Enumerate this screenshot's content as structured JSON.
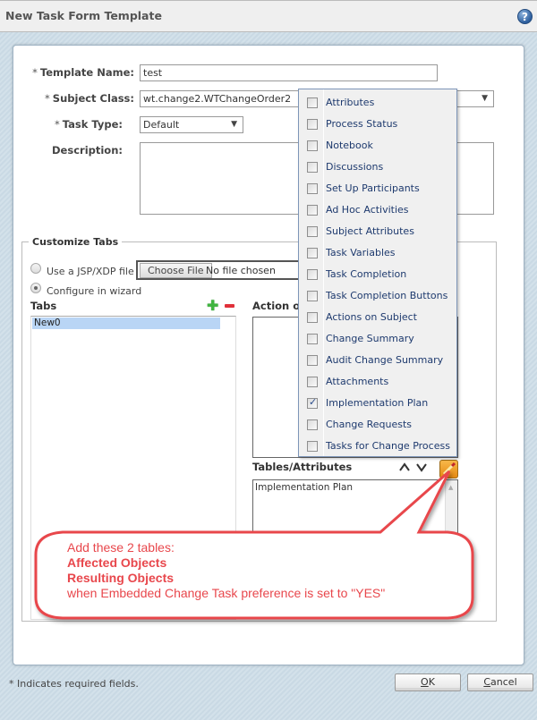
{
  "window": {
    "title": "New Task Form Template",
    "help_icon": "question-mark-icon"
  },
  "form": {
    "required_marker": "*",
    "template_name": {
      "label": "Template Name:",
      "value": "test",
      "required": true
    },
    "subject_class": {
      "label": "Subject Class:",
      "value": "wt.change2.WTChangeOrder2",
      "required": true
    },
    "task_type": {
      "label": "Task Type:",
      "value": "Default",
      "required": true
    },
    "description": {
      "label": "Description:",
      "value": ""
    }
  },
  "customize_tabs": {
    "legend": "Customize Tabs",
    "radio_jsp": {
      "label": "Use a JSP/XDP file",
      "selected": false
    },
    "radio_wizard": {
      "label": "Configure in wizard",
      "selected": true
    },
    "file_input": {
      "button": "Choose File",
      "status": "No file chosen"
    },
    "tabs_header": "Tabs",
    "tabs": [
      {
        "label": "New0",
        "selected": true
      }
    ],
    "action_header": "Action on",
    "tables_header": "Tables/Attributes",
    "tables_list": [
      "Implementation Plan"
    ]
  },
  "tables_dropdown": {
    "items": [
      {
        "label": "Attributes",
        "checked": false
      },
      {
        "label": "Process Status",
        "checked": false
      },
      {
        "label": "Notebook",
        "checked": false
      },
      {
        "label": "Discussions",
        "checked": false
      },
      {
        "label": "Set Up Participants",
        "checked": false
      },
      {
        "label": "Ad Hoc Activities",
        "checked": false
      },
      {
        "label": "Subject Attributes",
        "checked": false
      },
      {
        "label": "Task Variables",
        "checked": false
      },
      {
        "label": "Task Completion",
        "checked": false
      },
      {
        "label": "Task Completion Buttons",
        "checked": false
      },
      {
        "label": "Actions on Subject",
        "checked": false
      },
      {
        "label": "Change Summary",
        "checked": false
      },
      {
        "label": "Audit Change Summary",
        "checked": false
      },
      {
        "label": "Attachments",
        "checked": false
      },
      {
        "label": "Implementation Plan",
        "checked": true
      },
      {
        "label": "Change Requests",
        "checked": false
      },
      {
        "label": "Tasks for Change Process",
        "checked": false
      }
    ]
  },
  "callout": {
    "line1": "Add these 2 tables:",
    "line2": "Affected Objects",
    "line3": "Resulting Objects",
    "line4": "when Embedded Change Task preference is set to \"YES\"",
    "color": "#e8474c"
  },
  "footer": {
    "note": "* Indicates required fields.",
    "ok_label": "OK",
    "ok_accesskey": "O",
    "ok_rest": "K",
    "cancel_accesskey": "C",
    "cancel_rest": "ancel"
  }
}
